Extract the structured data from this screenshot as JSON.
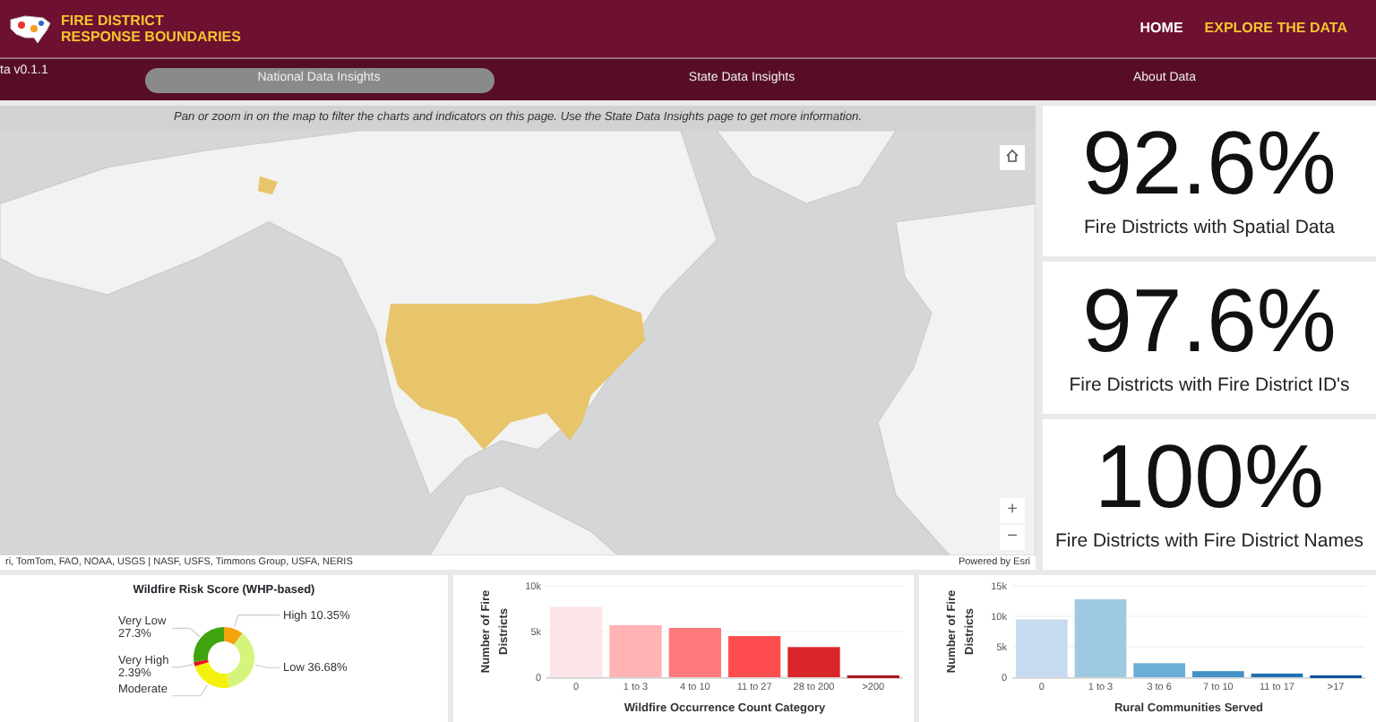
{
  "header": {
    "title_lines": [
      "FIRE DISTRICT",
      "RESPONSE BOUNDARIES"
    ],
    "nav": [
      {
        "label": "HOME",
        "selected": false
      },
      {
        "label": "EXPLORE THE DATA",
        "selected": true
      }
    ]
  },
  "subnav": {
    "version": "ta v0.1.1",
    "tabs": [
      {
        "label": "National Data Insights",
        "selected": true
      },
      {
        "label": "State Data Insights",
        "selected": false
      },
      {
        "label": "About Data",
        "selected": false
      }
    ]
  },
  "banner": "Pan or zoom in on the map to filter the charts and indicators on this page. Use the State Data Insights page to get more information.",
  "map": {
    "attribution": "ri, TomTom, FAO, NOAA, USGS | NASF, USFS, Timmons Group, USFA, NERIS",
    "powered_by": "Powered by Esri",
    "zoom_in": "+",
    "zoom_out": "−"
  },
  "indicators": [
    {
      "value": "92.6%",
      "label": "Fire Districts with Spatial Data"
    },
    {
      "value": "97.6%",
      "label": "Fire Districts with Fire District ID's"
    },
    {
      "value": "100%",
      "label": "Fire Districts with Fire District Names"
    }
  ],
  "charts": [
    {
      "title": "Wildfire Risk Score (WHP-based)",
      "chart_data": {
        "type": "donut",
        "categories": [
          "High",
          "Low",
          "Moderate",
          "Very High",
          "Very Low"
        ],
        "values": [
          10.35,
          36.68,
          23.28,
          2.39,
          27.3
        ],
        "colors": [
          "#f5a30a",
          "#d4f57a",
          "#f5f10e",
          "#e8141b",
          "#3fa30d"
        ],
        "value_labels": [
          "10.35%",
          "36.68%",
          null,
          "2.39%",
          "27.3%"
        ]
      }
    },
    {
      "chart_data": {
        "type": "bar",
        "xlabel": "Wildfire Occurrence Count Category",
        "ylabel": "Number of Fire Districts",
        "categories": [
          "0",
          "1 to 3",
          "4 to 10",
          "11 to 27",
          "28 to 200",
          ">200"
        ],
        "values": [
          7700,
          5700,
          5400,
          4500,
          3300,
          200
        ],
        "colors": [
          "#fce4e8",
          "#ffb3b5",
          "#ff7a7c",
          "#ff4d4f",
          "#d9262a",
          "#a8141a"
        ],
        "ylim": [
          0,
          10000
        ],
        "yticks": [
          {
            "value": 0,
            "label": "0"
          },
          {
            "value": 5000,
            "label": "5k"
          },
          {
            "value": 10000,
            "label": "10k"
          }
        ]
      }
    },
    {
      "chart_data": {
        "type": "bar",
        "xlabel": "Rural Communities Served",
        "ylabel": "Number of Fire Districts",
        "categories": [
          "0",
          "1 to 3",
          "3 to 6",
          "7 to 10",
          "11 to 17",
          ">17"
        ],
        "values": [
          9500,
          12800,
          2300,
          1000,
          600,
          300
        ],
        "colors": [
          "#c6dbef",
          "#9ecae1",
          "#6baed6",
          "#4292c6",
          "#2171b5",
          "#08519c"
        ],
        "ylim": [
          0,
          15000
        ],
        "yticks": [
          {
            "value": 0,
            "label": "0"
          },
          {
            "value": 5000,
            "label": "5k"
          },
          {
            "value": 10000,
            "label": "10k"
          },
          {
            "value": 15000,
            "label": "15k"
          }
        ]
      }
    }
  ]
}
